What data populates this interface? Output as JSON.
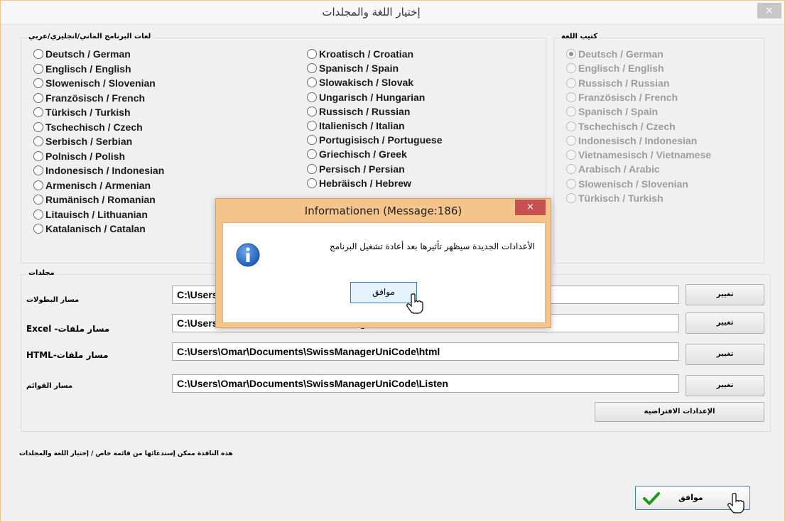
{
  "window": {
    "title": "إختيار اللغة والمجلدات",
    "close_icon": "×"
  },
  "program_languages": {
    "legend": "لغات البرنامج الماني/انجليزي/عربي",
    "col1": [
      "Deutsch / German",
      "Englisch / English",
      "Slowenisch / Slovenian",
      "Französisch / French",
      "Türkisch / Turkish",
      "Tschechisch / Czech",
      "Serbisch / Serbian",
      "Polnisch / Polish",
      "Indonesisch / Indonesian",
      "Armenisch / Armenian",
      "Rumänisch / Romanian",
      "Litauisch / Lithuanian",
      "Katalanisch / Catalan"
    ],
    "col2": [
      "Kroatisch / Croatian",
      "Spanisch / Spain",
      "Slowakisch / Slovak",
      "Ungarisch / Hungarian",
      "Russisch / Russian",
      "Italienisch / Italian",
      "Portugisisch / Portuguese",
      "Griechisch / Greek",
      "Persisch / Persian",
      "Hebräisch / Hebrew"
    ]
  },
  "book_language": {
    "legend": "كتيب اللغة",
    "items": [
      "Deutsch / German",
      "Englisch / English",
      "Russisch / Russian",
      "Französisch / French",
      "Spanisch / Spain",
      "Tschechisch / Czech",
      "Indonesisch / Indonesian",
      "Vietnamesisch / Vietnamese",
      "Arabisch / Arabic",
      "Slowenisch / Slovenian",
      "Türkisch / Turkish"
    ],
    "selected": "Deutsch / German"
  },
  "folders": {
    "legend": "مجلدات",
    "rows": [
      {
        "label": "مسار البطولات",
        "value": "C:\\Users",
        "button": "تغيير"
      },
      {
        "label": "Excel -مسار ملفات",
        "value": "C:\\Users\\Omar\\Documents\\SwissManagerUniCode\\Excel",
        "button": "تغيير"
      },
      {
        "label": "HTML-مسار ملفات",
        "value": "C:\\Users\\Omar\\Documents\\SwissManagerUniCode\\html",
        "button": "تغيير"
      },
      {
        "label": "مسار القوائم",
        "value": "C:\\Users\\Omar\\Documents\\SwissManagerUniCode\\Listen",
        "button": "تغيير"
      }
    ],
    "defaults_button": "الإعدادات الافتراضية"
  },
  "footer": {
    "info": "هذه النافذة ممكن إستدعائها من قائمة خاص / إختيار اللغة والمجلدات",
    "ok_label": "موافق"
  },
  "message_box": {
    "title": "Informationen (Message:186)",
    "text": "الأعدادات الجديدة سيظهر تأثيرها بعد أعادة تشغيل البرنامج",
    "ok_label": "موافق",
    "close_icon": "×"
  },
  "colors": {
    "msgbox_frame": "#f4c48a",
    "close_red": "#c75050",
    "check_green": "#1a9a1a",
    "info_icon_blue": "#1c5db5"
  }
}
